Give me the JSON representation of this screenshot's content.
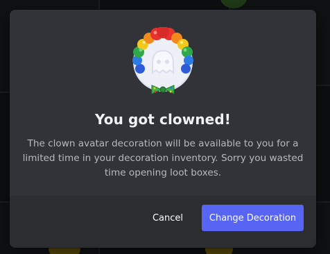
{
  "modal": {
    "title": "You got clowned!",
    "description": "The clown avatar decoration will be available to you for a limited time in your decoration inventory. Sorry you wasted time opening loot boxes.",
    "avatar_decoration": "clown-wig-bowtie-decoration",
    "cancel_label": "Cancel",
    "confirm_label": "Change Decoration"
  },
  "colors": {
    "modal_bg": "#313338",
    "footer_bg": "#2b2d31",
    "primary": "#5865f2",
    "title": "#f2f3f5",
    "text": "#b5bac1"
  }
}
